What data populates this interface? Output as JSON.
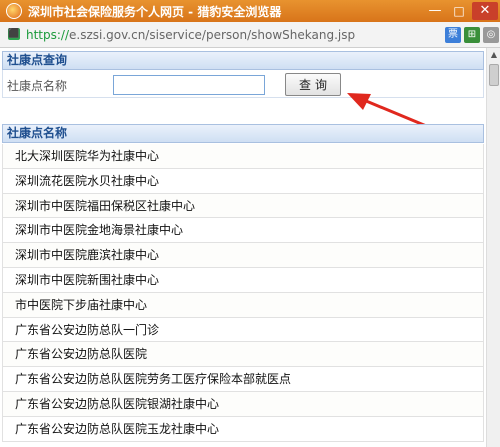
{
  "window": {
    "title": "深圳市社会保险服务个人网页 - 猎豹安全浏览器",
    "min_glyph": "—",
    "max_glyph": "□",
    "close_glyph": "✕",
    "app_icon": "cheetah-browser-icon"
  },
  "address": {
    "scheme": "https://",
    "rest": "e.szsi.gov.cn/siservice/person/showShekang.jsp",
    "lock_icon": "lock-icon",
    "extensions": [
      "票",
      "⊞",
      "◎"
    ]
  },
  "query_section": {
    "header": "社康点查询",
    "label": "社康点名称",
    "input_value": "",
    "button": "查询"
  },
  "list_section": {
    "header": "社康点名称",
    "items": [
      "北大深圳医院华为社康中心",
      "深圳流花医院水贝社康中心",
      "深圳市中医院福田保税区社康中心",
      "深圳市中医院金地海景社康中心",
      "深圳市中医院鹿滨社康中心",
      "深圳市中医院新围社康中心",
      "市中医院下步庙社康中心",
      "广东省公安边防总队一门诊",
      "广东省公安边防总队医院",
      "广东省公安边防总队医院劳务工医疗保险本部就医点",
      "广东省公安边防总队医院银湖社康中心",
      "广东省公安边防总队医院玉龙社康中心"
    ]
  },
  "annotation": {
    "arrow_color": "#e0281e"
  }
}
